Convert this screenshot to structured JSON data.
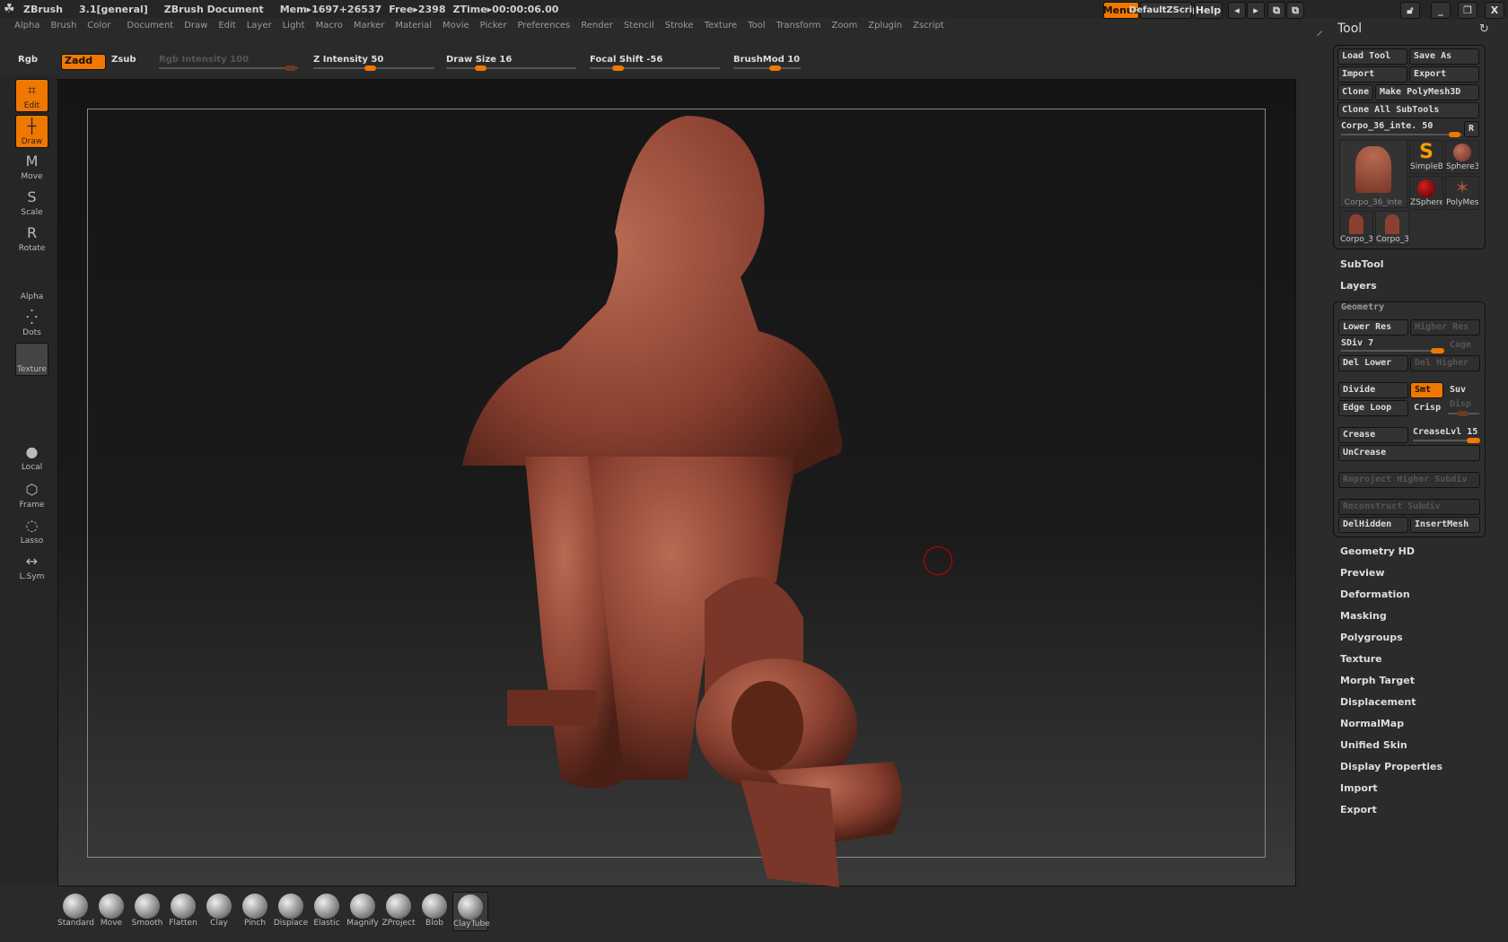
{
  "titlebar": {
    "app": "ZBrush",
    "version": "3.1[general]",
    "document": "ZBrush Document",
    "mem": "Mem▸1697+26537",
    "free": "Free▸2398",
    "ztime": "ZTime▸00:00:06.00"
  },
  "topbuttons": {
    "menus": "Menus",
    "script": "DefaultZScript",
    "help": "Help"
  },
  "menus": [
    "Alpha",
    "Brush",
    "Color",
    "Document",
    "Draw",
    "Edit",
    "Layer",
    "Light",
    "Macro",
    "Marker",
    "Material",
    "Movie",
    "Picker",
    "Preferences",
    "Render",
    "Stencil",
    "Stroke",
    "Texture",
    "Tool",
    "Transform",
    "Zoom",
    "Zplugin",
    "Zscript"
  ],
  "brushrow": {
    "rgb": "Rgb",
    "zadd": "Zadd",
    "zsub": "Zsub",
    "rgb_intensity": "Rgb Intensity 100",
    "z_intensity": "Z Intensity 50",
    "draw_size": "Draw Size 16",
    "focal_shift": "Focal Shift -56",
    "brushmod": "BrushMod 10",
    "values": {
      "rgb_intensity": 100,
      "z_intensity": 50,
      "draw_size": 16,
      "focal_shift": -56,
      "brushmod": 10
    }
  },
  "lefttools": [
    {
      "label": "Edit",
      "icon": "edit-icon",
      "active": true
    },
    {
      "label": "Draw",
      "icon": "draw-icon",
      "active": true
    },
    {
      "label": "Move",
      "icon": "move-icon"
    },
    {
      "label": "Scale",
      "icon": "scale-icon"
    },
    {
      "label": "Rotate",
      "icon": "rotate-icon"
    },
    {
      "label": "Alpha",
      "icon": "alpha-icon"
    },
    {
      "label": "Dots",
      "icon": "dots-icon"
    },
    {
      "label": "Texture",
      "icon": "texture-icon"
    },
    {
      "label": "Local",
      "icon": "local-icon"
    },
    {
      "label": "Frame",
      "icon": "frame-icon"
    },
    {
      "label": "Lasso",
      "icon": "lasso-icon"
    },
    {
      "label": "L.Sym",
      "icon": "symmetry-icon"
    }
  ],
  "brushes": [
    "Standard",
    "Move",
    "Smooth",
    "Flatten",
    "Clay",
    "Pinch",
    "Displace",
    "Elastic",
    "Magnify",
    "ZProject",
    "Blob",
    "ClayTube"
  ],
  "tool": {
    "title": "Tool",
    "load": "Load Tool",
    "save": "Save As",
    "import": "Import",
    "export": "Export",
    "clone": "Clone",
    "make": "Make PolyMesh3D",
    "cloneall": "Clone All SubTools",
    "current": "Corpo_36_inte. 50",
    "r": "R",
    "thumbs": {
      "main": "Corpo_36_inte",
      "simple": "SimpleBr",
      "sphere": "Sphere3",
      "zsphere": "ZSphere",
      "poly": "PolyMes",
      "c1": "Corpo_3",
      "c2": "Corpo_3"
    }
  },
  "subtool": "SubTool",
  "layers": "Layers",
  "geometry": {
    "title": "Geometry",
    "lower": "Lower Res",
    "higher": "Higher Res",
    "sdiv": "SDiv 7",
    "cage": "Cage",
    "dellower": "Del Lower",
    "delhigher": "Del Higher",
    "divide": "Divide",
    "smt": "Smt",
    "suv": "Suv",
    "edgeloop": "Edge Loop",
    "crisp": "Crisp",
    "disp": "Disp",
    "crease": "Crease",
    "creaselvl": "CreaseLvl 15",
    "uncrease": "UnCrease",
    "reproject": "Reproject Higher Subdiv",
    "reconstruct": "Reconstruct Subdiv",
    "delhidden": "DelHidden",
    "insertmesh": "InsertMesh",
    "sdiv_value": 7,
    "creaselvl_value": 15
  },
  "sections": [
    "Geometry HD",
    "Preview",
    "Deformation",
    "Masking",
    "Polygroups",
    "Texture",
    "Morph Target",
    "Displacement",
    "NormalMap",
    "Unified Skin",
    "Display Properties",
    "Import",
    "Export"
  ],
  "colors": {
    "accent": "#f07800",
    "model": "#8a4030",
    "background": "#2a2a2a"
  }
}
